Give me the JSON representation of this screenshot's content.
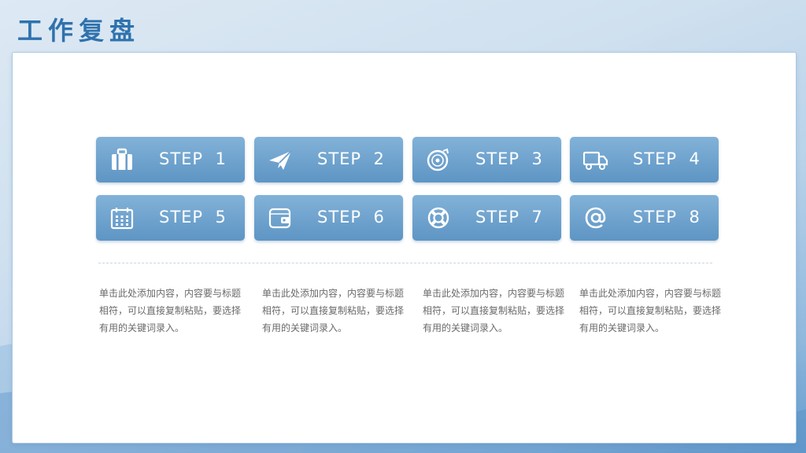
{
  "title": "工作复盘",
  "steps": [
    {
      "label": "STEP  1",
      "icon": "suitcase-icon"
    },
    {
      "label": "STEP  2",
      "icon": "paper-plane-icon"
    },
    {
      "label": "STEP  3",
      "icon": "disc-icon"
    },
    {
      "label": "STEP  4",
      "icon": "truck-icon"
    },
    {
      "label": "STEP  5",
      "icon": "calendar-icon"
    },
    {
      "label": "STEP  6",
      "icon": "wallet-icon"
    },
    {
      "label": "STEP  7",
      "icon": "lifebuoy-icon"
    },
    {
      "label": "STEP  8",
      "icon": "at-sign-icon"
    }
  ],
  "descriptions": [
    "单击此处添加内容，内容要与标题相符，可以直接复制粘贴，要选择有用的关键词录入。",
    "单击此处添加内容，内容要与标题相符，可以直接复制粘贴，要选择有用的关键词录入。",
    "单击此处添加内容，内容要与标题相符，可以直接复制粘贴，要选择有用的关键词录入。",
    "单击此处添加内容，内容要与标题相符，可以直接复制粘贴，要选择有用的关键词录入。"
  ],
  "colors": {
    "title": "#2f72ad",
    "button_top": "#82b2d8",
    "button_bottom": "#5e95c4",
    "text": "#6a6a6a"
  }
}
